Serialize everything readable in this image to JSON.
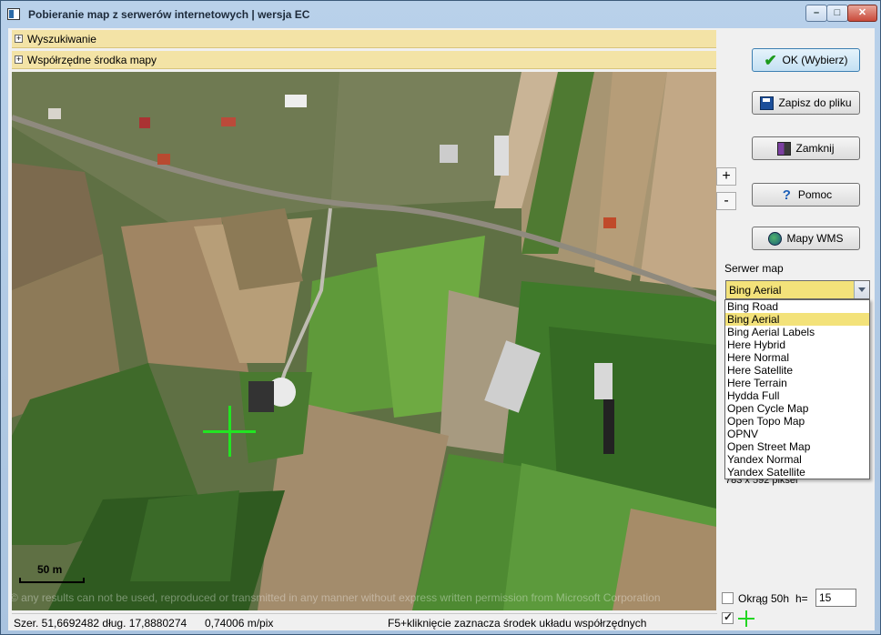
{
  "window": {
    "title": "Pobieranie map z serwerów internetowych  |  wersja EC",
    "minimize_label": "–",
    "maximize_label": "□",
    "close_label": "✕"
  },
  "sections": {
    "search_label": "Wyszukiwanie",
    "center_coords_label": "Współrzędne środka mapy"
  },
  "map": {
    "scale_label": "50 m",
    "copyright": "© any results can not be used, reproduced or transmitted in any manner without express written permission from Microsoft Corporation",
    "zoom_in_label": "+",
    "zoom_out_label": "-"
  },
  "buttons": {
    "ok_label": "OK (Wybierz)",
    "save_label": "Zapisz do pliku",
    "close_label": "Zamknij",
    "help_label": "Pomoc",
    "wms_label": "Mapy WMS"
  },
  "server": {
    "label": "Serwer map",
    "selected": "Bing Aerial",
    "options": [
      "Bing Road",
      "Bing Aerial",
      "Bing Aerial Labels",
      "Here Hybrid",
      "Here Normal",
      "Here Satellite",
      "Here Terrain",
      "Hydda Full",
      "Open Cycle Map",
      "Open Topo Map",
      "OPNV",
      "Open Street Map",
      "Yandex Normal",
      "Yandex Satellite"
    ],
    "selected_index": 1
  },
  "size_label": "783 x 592 piksel",
  "circle": {
    "label": "Okrąg 50h",
    "checked": false,
    "h_label": "h=",
    "h_value": "15"
  },
  "crosshair_toggle": {
    "checked": true
  },
  "status": {
    "coords": "Szer. 51,6692482 dług. 17,8880274",
    "resolution": "0,74006 m/pix",
    "hint": "F5+kliknięcie zaznacza środek układu współrzędnych"
  },
  "colors": {
    "section_bar": "#f3e3a6",
    "combo_selected": "#f3e27a",
    "crosshair": "#22e522"
  }
}
